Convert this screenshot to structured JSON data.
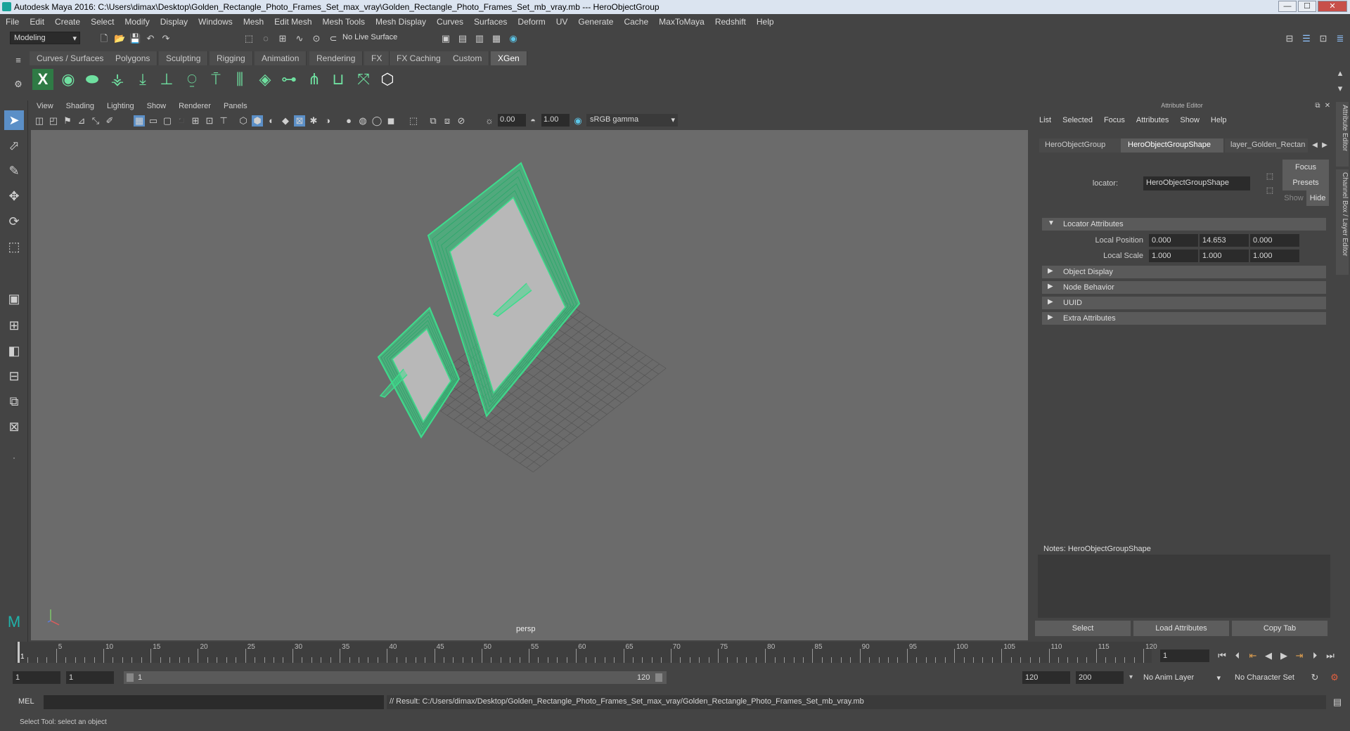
{
  "window": {
    "title": "Autodesk Maya 2016: C:\\Users\\dimax\\Desktop\\Golden_Rectangle_Photo_Frames_Set_max_vray\\Golden_Rectangle_Photo_Frames_Set_mb_vray.mb   ---   HeroObjectGroup",
    "minimize": "—",
    "maximize": "☐",
    "close": "✕"
  },
  "menubar": [
    "File",
    "Edit",
    "Create",
    "Select",
    "Modify",
    "Display",
    "Windows",
    "Mesh",
    "Edit Mesh",
    "Mesh Tools",
    "Mesh Display",
    "Curves",
    "Surfaces",
    "Deform",
    "UV",
    "Generate",
    "Cache",
    "MaxToMaya",
    "Redshift",
    "Help"
  ],
  "statusline": {
    "mode": "Modeling",
    "live_surface": "No Live Surface"
  },
  "shelf": {
    "tabs": [
      "Curves / Surfaces",
      "Polygons",
      "Sculpting",
      "Rigging",
      "Animation",
      "Rendering",
      "FX",
      "FX Caching",
      "Custom",
      "XGen"
    ],
    "active_tab": "XGen"
  },
  "viewport": {
    "menu": [
      "View",
      "Shading",
      "Lighting",
      "Show",
      "Renderer",
      "Panels"
    ],
    "exposure": "0.00",
    "gamma": "1.00",
    "color_space": "sRGB gamma",
    "camera_label": "persp"
  },
  "attribute_editor": {
    "header": "Attribute Editor",
    "menu": [
      "List",
      "Selected",
      "Focus",
      "Attributes",
      "Show",
      "Help"
    ],
    "tabs": [
      "HeroObjectGroup",
      "HeroObjectGroupShape",
      "layer_Golden_Rectan"
    ],
    "active_tab": "HeroObjectGroupShape",
    "locator_label": "locator:",
    "locator_value": "HeroObjectGroupShape",
    "focus_button": "Focus",
    "presets_button": "Presets",
    "show_button": "Show",
    "hide_button": "Hide",
    "sections": [
      {
        "label": "Locator Attributes",
        "expanded": true
      },
      {
        "label": "Object Display",
        "expanded": false
      },
      {
        "label": "Node Behavior",
        "expanded": false
      },
      {
        "label": "UUID",
        "expanded": false
      },
      {
        "label": "Extra Attributes",
        "expanded": false
      }
    ],
    "local_position_label": "Local Position",
    "local_position": [
      "0.000",
      "14.653",
      "0.000"
    ],
    "local_scale_label": "Local Scale",
    "local_scale": [
      "1.000",
      "1.000",
      "1.000"
    ],
    "notes_label": "Notes:  HeroObjectGroupShape",
    "bottom_buttons": [
      "Select",
      "Load Attributes",
      "Copy Tab"
    ]
  },
  "side_tabs": [
    "Attribute Editor",
    "Channel Box / Layer Editor"
  ],
  "timeline": {
    "ticks": [
      1,
      5,
      10,
      15,
      20,
      25,
      30,
      35,
      40,
      45,
      50,
      55,
      60,
      65,
      70,
      75,
      80,
      85,
      90,
      95,
      100,
      105,
      110,
      115,
      120
    ],
    "current_frame": "1"
  },
  "range": {
    "start": "1",
    "start2": "1",
    "inner_start": "1",
    "inner_end": "120",
    "end": "120",
    "end2": "200",
    "anim_layer": "No Anim Layer",
    "char_set": "No Character Set"
  },
  "cmdline": {
    "lang": "MEL",
    "result": "// Result: C:/Users/dimax/Desktop/Golden_Rectangle_Photo_Frames_Set_max_vray/Golden_Rectangle_Photo_Frames_Set_mb_vray.mb"
  },
  "helpline": "Select Tool: select an object",
  "colors": {
    "frame_wire": "#3ddc8c",
    "viewport_bg": "#6b6b6b",
    "panel_bg": "#444444"
  }
}
